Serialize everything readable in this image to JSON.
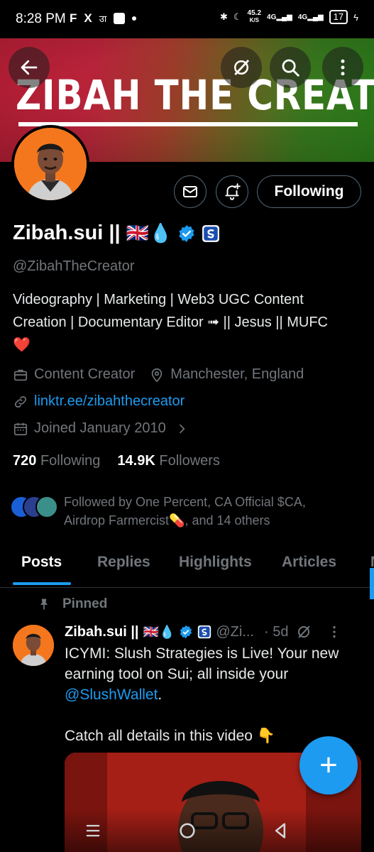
{
  "status_bar": {
    "time": "8:28 PM",
    "left_icons": [
      "F",
      "X",
      "उा"
    ],
    "net_speed_value": "45.2",
    "net_speed_unit": "K/S",
    "signal_1": "4G",
    "signal_2": "4G",
    "battery": "17"
  },
  "banner": {
    "title": "ZIBAH THE CREATOR",
    "colors": {
      "left": "#c8213a",
      "right": "#2f8a1c"
    }
  },
  "profile": {
    "name": "Zibah.sui ||",
    "name_emojis": "🇬🇧💧",
    "handle": "@ZibahTheCreator",
    "bio_line1": "Videography | Marketing | Web3 UGC Content",
    "bio_line2": "Creation | Documentary Editor ➟ || Jesus || MUFC",
    "bio_line3": "❤️",
    "category": "Content Creator",
    "location": "Manchester, England",
    "link": "linktr.ee/zibahthecreator",
    "joined": "Joined January 2010",
    "following_count": "720",
    "following_label": "Following",
    "followers_count": "14.9K",
    "followers_label": "Followers",
    "followed_by_line1": "Followed by One Percent, CA Official $CA,",
    "followed_by_line2": "Airdrop Farmercist💊, and 14 others",
    "following_button": "Following"
  },
  "tabs": [
    "Posts",
    "Replies",
    "Highlights",
    "Articles",
    "M"
  ],
  "active_tab": "Posts",
  "post": {
    "pinned_label": "Pinned",
    "author": "Zibah.sui ||",
    "author_emojis": "🇬🇧💧",
    "handle": "@Zi...",
    "time": "· 5d",
    "text_line1": "ICYMI: Slush Strategies is Live! Your new",
    "text_line2": "earning tool on Sui; all inside your",
    "mention": "@SlushWallet",
    "mention_suffix": ".",
    "text_line4": "Catch all details in this video 👇"
  },
  "fab_label": "+",
  "colors": {
    "accent": "#1d9bf0",
    "background": "#000000",
    "muted": "#71767b"
  }
}
